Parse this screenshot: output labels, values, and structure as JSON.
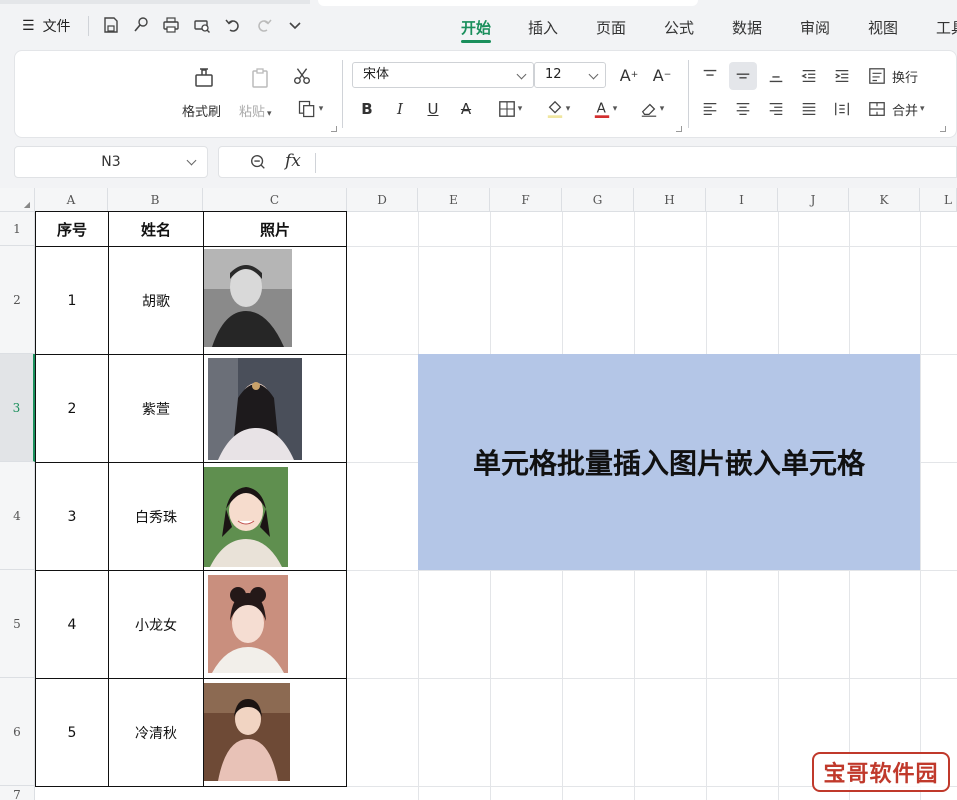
{
  "menubar": {
    "file_label": "文件",
    "tabs": [
      "开始",
      "插入",
      "页面",
      "公式",
      "数据",
      "审阅",
      "视图",
      "工具"
    ],
    "active_tab": "开始"
  },
  "ribbon": {
    "format_painter": "格式刷",
    "paste": "粘贴",
    "font_name": "宋体",
    "font_size": "12",
    "wrap": "换行",
    "merge": "合并",
    "font_color": "#d32f2f",
    "fill_color": "#f0e6a0"
  },
  "formula": {
    "cell_ref": "N3",
    "fx": "fx",
    "content": ""
  },
  "grid": {
    "columns": [
      "A",
      "B",
      "C",
      "D",
      "E",
      "F",
      "G",
      "H",
      "I",
      "J",
      "K",
      "L"
    ],
    "rows": [
      "1",
      "2",
      "3",
      "4",
      "5",
      "6",
      "7"
    ],
    "selected_row": "3"
  },
  "table": {
    "headers": [
      "序号",
      "姓名",
      "照片"
    ],
    "rows": [
      {
        "no": "1",
        "name": "胡歌"
      },
      {
        "no": "2",
        "name": "紫萱"
      },
      {
        "no": "3",
        "name": "白秀珠"
      },
      {
        "no": "4",
        "name": "小龙女"
      },
      {
        "no": "5",
        "name": "冷清秋"
      }
    ]
  },
  "merged_cell": {
    "text": "单元格批量插入图片嵌入单元格",
    "bg": "#b4c6e7"
  },
  "watermark": "宝哥软件园",
  "icons": {
    "menu": "menu-icon",
    "save": "save-icon",
    "brush": "brush-icon",
    "print": "print-icon",
    "preview": "print-preview-icon",
    "undo": "undo-icon",
    "redo": "redo-icon",
    "more": "chevron-down-icon",
    "zoom": "zoom-icon"
  }
}
